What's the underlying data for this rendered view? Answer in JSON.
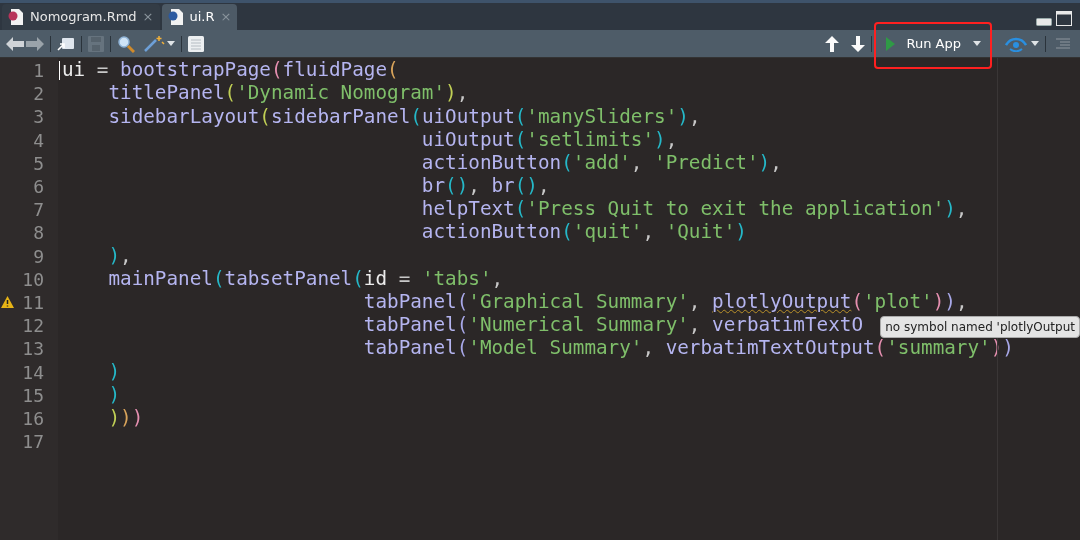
{
  "tabs": [
    {
      "label": "Nomogram.Rmd",
      "kind": "rmd",
      "selected": false,
      "close": "×"
    },
    {
      "label": "ui.R",
      "kind": "r",
      "selected": true,
      "close": "×"
    }
  ],
  "toolbar": {
    "run_app": {
      "label": "Run App",
      "highlighted": true
    },
    "save_disabled": true
  },
  "editor": {
    "lines": [
      {
        "number": "1",
        "tokens": [
          {
            "text": "ui",
            "kind": "var"
          },
          {
            "text": " = ",
            "kind": "punct"
          },
          {
            "text": "bootstrapPage",
            "kind": "id"
          },
          {
            "text": "(",
            "kind": "paren",
            "color": "#e58fb0"
          },
          {
            "text": "fluidPage",
            "kind": "id"
          },
          {
            "text": "(",
            "kind": "paren",
            "color": "#d9a45b"
          }
        ]
      },
      {
        "number": "2",
        "tokens": [
          {
            "text": "    titlePanel",
            "kind": "id"
          },
          {
            "text": "(",
            "kind": "paren",
            "color": "#c0cf55"
          },
          {
            "text": "'Dynamic Nomogram'",
            "kind": "str"
          },
          {
            "text": ")",
            "kind": "paren",
            "color": "#c0cf55"
          },
          {
            "text": ",",
            "kind": "punct"
          }
        ]
      },
      {
        "number": "3",
        "tokens": [
          {
            "text": "    sidebarLayout",
            "kind": "id"
          },
          {
            "text": "(",
            "kind": "paren",
            "color": "#c0cf55"
          },
          {
            "text": "sidebarPanel",
            "kind": "id"
          },
          {
            "text": "(",
            "kind": "paren",
            "color": "#25b8c8"
          },
          {
            "text": "uiOutput",
            "kind": "id"
          },
          {
            "text": "(",
            "kind": "paren",
            "color": "#25b8c8"
          },
          {
            "text": "'manySliders'",
            "kind": "str"
          },
          {
            "text": ")",
            "kind": "paren",
            "color": "#25b8c8"
          },
          {
            "text": ",",
            "kind": "punct"
          }
        ]
      },
      {
        "number": "4",
        "tokens": [
          {
            "text": "                               uiOutput",
            "kind": "id"
          },
          {
            "text": "(",
            "kind": "paren",
            "color": "#25b8c8"
          },
          {
            "text": "'setlimits'",
            "kind": "str"
          },
          {
            "text": ")",
            "kind": "paren",
            "color": "#25b8c8"
          },
          {
            "text": ",",
            "kind": "punct"
          }
        ]
      },
      {
        "number": "5",
        "tokens": [
          {
            "text": "                               actionButton",
            "kind": "id"
          },
          {
            "text": "(",
            "kind": "paren",
            "color": "#25b8c8"
          },
          {
            "text": "'add'",
            "kind": "str"
          },
          {
            "text": ", ",
            "kind": "punct"
          },
          {
            "text": "'Predict'",
            "kind": "str"
          },
          {
            "text": ")",
            "kind": "paren",
            "color": "#25b8c8"
          },
          {
            "text": ",",
            "kind": "punct"
          }
        ]
      },
      {
        "number": "6",
        "tokens": [
          {
            "text": "                               br",
            "kind": "id"
          },
          {
            "text": "()",
            "kind": "paren",
            "color": "#25b8c8"
          },
          {
            "text": ", ",
            "kind": "punct"
          },
          {
            "text": "br",
            "kind": "id"
          },
          {
            "text": "()",
            "kind": "paren",
            "color": "#25b8c8"
          },
          {
            "text": ",",
            "kind": "punct"
          }
        ]
      },
      {
        "number": "7",
        "tokens": [
          {
            "text": "                               helpText",
            "kind": "id"
          },
          {
            "text": "(",
            "kind": "paren",
            "color": "#25b8c8"
          },
          {
            "text": "'Press Quit to exit the application'",
            "kind": "str"
          },
          {
            "text": ")",
            "kind": "paren",
            "color": "#25b8c8"
          },
          {
            "text": ",",
            "kind": "punct"
          }
        ]
      },
      {
        "number": "8",
        "tokens": [
          {
            "text": "                               actionButton",
            "kind": "id"
          },
          {
            "text": "(",
            "kind": "paren",
            "color": "#25b8c8"
          },
          {
            "text": "'quit'",
            "kind": "str"
          },
          {
            "text": ", ",
            "kind": "punct"
          },
          {
            "text": "'Quit'",
            "kind": "str"
          },
          {
            "text": ")",
            "kind": "paren",
            "color": "#25b8c8"
          }
        ]
      },
      {
        "number": "9",
        "tokens": [
          {
            "text": "    )",
            "kind": "paren",
            "color": "#25b8c8"
          },
          {
            "text": ",",
            "kind": "punct"
          }
        ]
      },
      {
        "number": "10",
        "tokens": [
          {
            "text": "    mainPanel",
            "kind": "id"
          },
          {
            "text": "(",
            "kind": "paren",
            "color": "#25b8c8"
          },
          {
            "text": "tabsetPanel",
            "kind": "id"
          },
          {
            "text": "(",
            "kind": "paren",
            "color": "#25b8c8"
          },
          {
            "text": "id",
            "kind": "var"
          },
          {
            "text": " = ",
            "kind": "punct"
          },
          {
            "text": "'tabs'",
            "kind": "str"
          },
          {
            "text": ",",
            "kind": "punct"
          }
        ]
      },
      {
        "number": "11",
        "warning": true,
        "tokens": [
          {
            "text": "                          tabPanel",
            "kind": "id"
          },
          {
            "text": "(",
            "kind": "paren",
            "color": "#a8a8e8"
          },
          {
            "text": "'Graphical Summary'",
            "kind": "str"
          },
          {
            "text": ", ",
            "kind": "punct"
          },
          {
            "text": "plotlyOutput",
            "kind": "id",
            "squiggle": true
          },
          {
            "text": "(",
            "kind": "paren",
            "color": "#e58fb0"
          },
          {
            "text": "'plot'",
            "kind": "str"
          },
          {
            "text": ")",
            "kind": "paren",
            "color": "#e58fb0"
          },
          {
            "text": ")",
            "kind": "paren",
            "color": "#a8a8e8"
          },
          {
            "text": ",",
            "kind": "punct"
          }
        ]
      },
      {
        "number": "12",
        "tokens": [
          {
            "text": "                          tabPanel",
            "kind": "id"
          },
          {
            "text": "(",
            "kind": "paren",
            "color": "#a8a8e8"
          },
          {
            "text": "'Numerical Summary'",
            "kind": "str"
          },
          {
            "text": ", ",
            "kind": "punct"
          },
          {
            "text": "verbatimTextO",
            "kind": "id"
          }
        ]
      },
      {
        "number": "13",
        "tokens": [
          {
            "text": "                          tabPanel",
            "kind": "id"
          },
          {
            "text": "(",
            "kind": "paren",
            "color": "#a8a8e8"
          },
          {
            "text": "'Model Summary'",
            "kind": "str"
          },
          {
            "text": ", ",
            "kind": "punct"
          },
          {
            "text": "verbatimTextOutput",
            "kind": "id"
          },
          {
            "text": "(",
            "kind": "paren",
            "color": "#e58fb0"
          },
          {
            "text": "'summary'",
            "kind": "str"
          },
          {
            "text": ")",
            "kind": "paren",
            "color": "#e58fb0"
          },
          {
            "text": ")",
            "kind": "paren",
            "color": "#a8a8e8"
          }
        ]
      },
      {
        "number": "14",
        "tokens": [
          {
            "text": "    )",
            "kind": "paren",
            "color": "#25b8c8"
          }
        ]
      },
      {
        "number": "15",
        "tokens": [
          {
            "text": "    )",
            "kind": "paren",
            "color": "#25b8c8"
          }
        ]
      },
      {
        "number": "16",
        "tokens": [
          {
            "text": "    )",
            "kind": "paren",
            "color": "#c0cf55"
          },
          {
            "text": ")",
            "kind": "paren",
            "color": "#d9a45b"
          },
          {
            "text": ")",
            "kind": "paren",
            "color": "#e58fb0"
          }
        ]
      },
      {
        "number": "17"
      }
    ],
    "tooltip": {
      "text": "no symbol named 'plotlyOutput"
    }
  }
}
